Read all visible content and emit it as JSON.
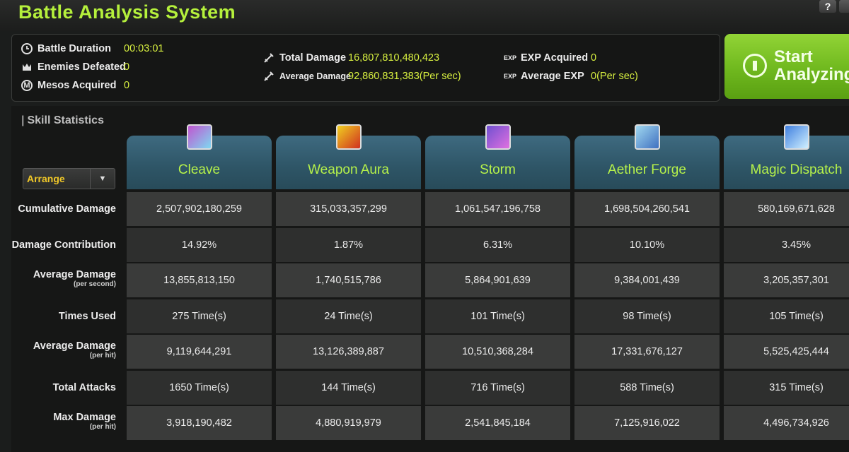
{
  "app": {
    "title": "Battle Analysis System",
    "help": "?"
  },
  "summary": {
    "battle_duration": {
      "label": "Battle Duration",
      "value": "00:03:01",
      "icon": "clock-icon"
    },
    "enemies_defeated": {
      "label": "Enemies Defeated",
      "value": "0",
      "icon": "crown-icon"
    },
    "mesos_acquired": {
      "label": "Mesos Acquired",
      "value": "0",
      "icon": "meso-icon",
      "icon_text": "M"
    },
    "total_damage": {
      "label": "Total Damage",
      "value": "16,807,810,480,423",
      "icon": "sword-icon"
    },
    "average_damage": {
      "label": "Average Damage",
      "value": "92,860,831,383(Per sec)",
      "icon": "sword-icon"
    },
    "exp_acquired": {
      "tag": "EXP",
      "label": "EXP Acquired",
      "value": "0"
    },
    "average_exp": {
      "tag": "EXP",
      "label": "Average EXP",
      "value": "0(Per sec)"
    }
  },
  "start_button": {
    "line1": "Start",
    "line2": "Analyzing"
  },
  "skill_statistics": {
    "title": "Skill Statistics",
    "arrange_label": "Arrange",
    "row_labels": [
      {
        "main": "Cumulative Damage",
        "sub": ""
      },
      {
        "main": "Damage Contribution",
        "sub": ""
      },
      {
        "main": "Average Damage",
        "sub": "(per second)"
      },
      {
        "main": "Times Used",
        "sub": ""
      },
      {
        "main": "Average Damage",
        "sub": "(per hit)"
      },
      {
        "main": "Total Attacks",
        "sub": ""
      },
      {
        "main": "Max Damage",
        "sub": "(per hit)"
      }
    ],
    "skills": [
      {
        "name": "Cleave",
        "icon": "cleave-skill-icon",
        "colors": [
          "#c055d0",
          "#7fd8f0"
        ],
        "values": [
          "2,507,902,180,259",
          "14.92%",
          "13,855,813,150",
          "275 Time(s)",
          "9,119,644,291",
          "1650 Time(s)",
          "3,918,190,482"
        ]
      },
      {
        "name": "Weapon Aura",
        "icon": "weapon-aura-skill-icon",
        "colors": [
          "#f0d020",
          "#d03020"
        ],
        "values": [
          "315,033,357,299",
          "1.87%",
          "1,740,515,786",
          "24 Time(s)",
          "13,126,389,887",
          "144 Time(s)",
          "4,880,919,979"
        ]
      },
      {
        "name": "Storm",
        "icon": "storm-skill-icon",
        "colors": [
          "#7050d0",
          "#e070e0"
        ],
        "values": [
          "1,061,547,196,758",
          "6.31%",
          "5,864,901,639",
          "101 Time(s)",
          "10,510,368,284",
          "716 Time(s)",
          "2,541,845,184"
        ]
      },
      {
        "name": "Aether Forge",
        "icon": "aether-forge-skill-icon",
        "colors": [
          "#a0d8f0",
          "#4070c0"
        ],
        "values": [
          "1,698,504,260,541",
          "10.10%",
          "9,384,001,439",
          "98 Time(s)",
          "17,331,676,127",
          "588 Time(s)",
          "7,125,916,022"
        ]
      },
      {
        "name": "Magic Dispatch",
        "icon": "magic-dispatch-skill-icon",
        "colors": [
          "#4080e0",
          "#d0f0ff"
        ],
        "values": [
          "580,169,671,628",
          "3.45%",
          "3,205,357,301",
          "105 Time(s)",
          "5,525,425,444",
          "315 Time(s)",
          "4,496,734,926"
        ]
      }
    ]
  }
}
